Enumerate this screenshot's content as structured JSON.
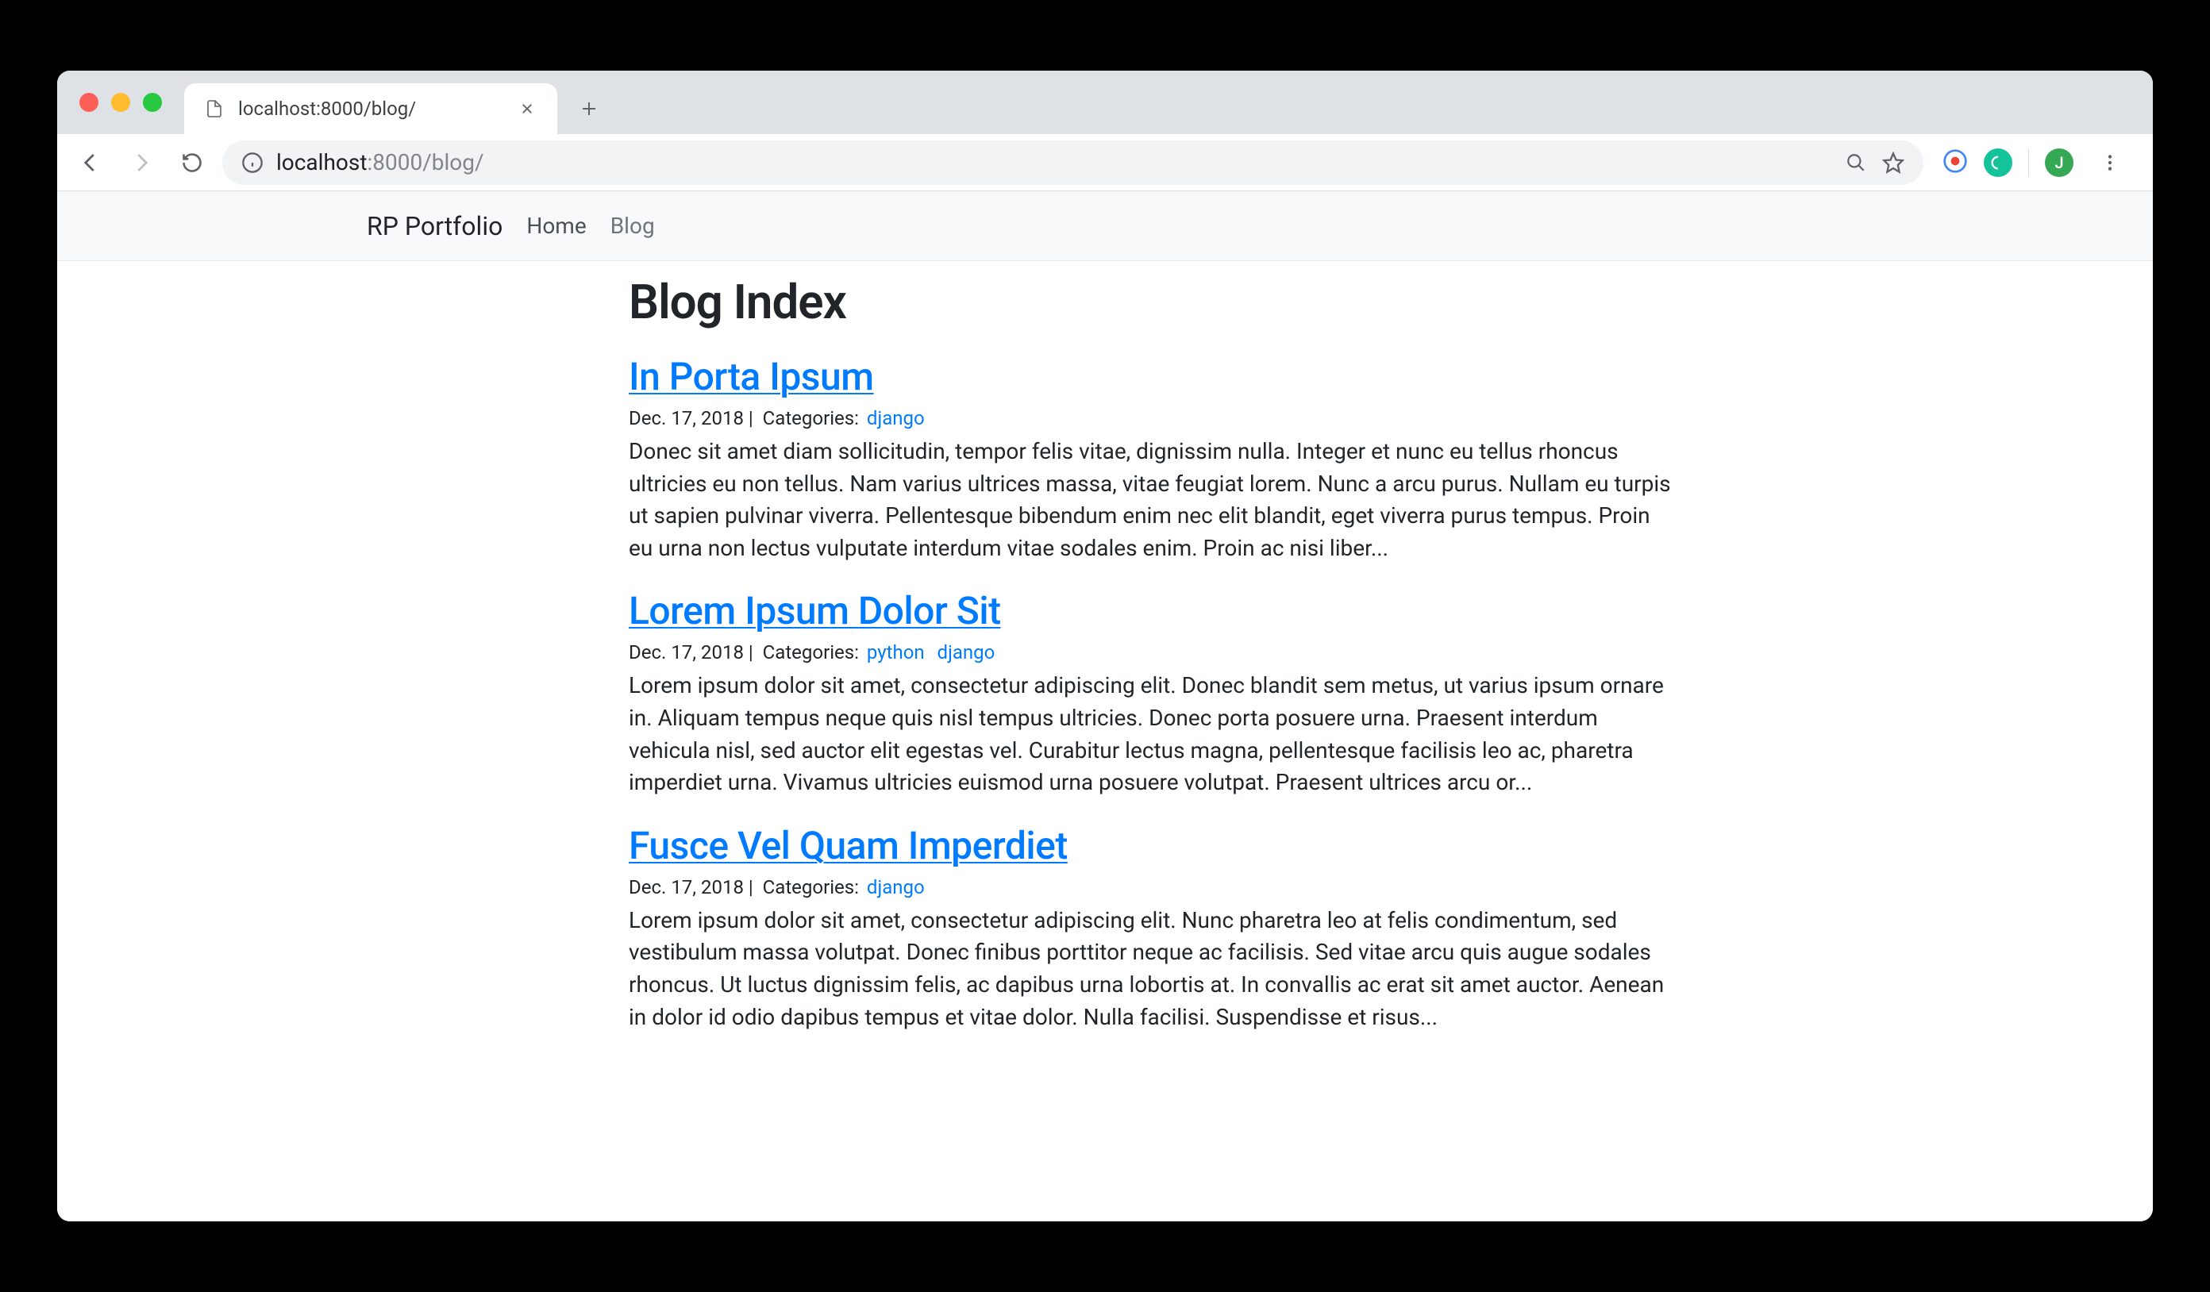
{
  "browser": {
    "tab_title": "localhost:8000/blog/",
    "url_host": "localhost",
    "url_port_path": ":8000/blog/"
  },
  "navbar": {
    "brand": "RP Portfolio",
    "links": [
      {
        "label": "Home"
      },
      {
        "label": "Blog"
      }
    ]
  },
  "page": {
    "heading": "Blog Index"
  },
  "posts": [
    {
      "title": "In Porta Ipsum",
      "date": "Dec. 17, 2018",
      "categories_label": "Categories:",
      "categories": [
        "django"
      ],
      "body": "Donec sit amet diam sollicitudin, tempor felis vitae, dignissim nulla. Integer et nunc eu tellus rhoncus ultricies eu non tellus. Nam varius ultrices massa, vitae feugiat lorem. Nunc a arcu purus. Nullam eu turpis ut sapien pulvinar viverra. Pellentesque bibendum enim nec elit blandit, eget viverra purus tempus. Proin eu urna non lectus vulputate interdum vitae sodales enim. Proin ac nisi liber..."
    },
    {
      "title": "Lorem Ipsum Dolor Sit",
      "date": "Dec. 17, 2018",
      "categories_label": "Categories:",
      "categories": [
        "python",
        "django"
      ],
      "body": "Lorem ipsum dolor sit amet, consectetur adipiscing elit. Donec blandit sem metus, ut varius ipsum ornare in. Aliquam tempus neque quis nisl tempus ultricies. Donec porta posuere urna. Praesent interdum vehicula nisl, sed auctor elit egestas vel. Curabitur lectus magna, pellentesque facilisis leo ac, pharetra imperdiet urna. Vivamus ultricies euismod urna posuere volutpat. Praesent ultrices arcu or..."
    },
    {
      "title": "Fusce Vel Quam Imperdiet",
      "date": "Dec. 17, 2018",
      "categories_label": "Categories:",
      "categories": [
        "django"
      ],
      "body": "Lorem ipsum dolor sit amet, consectetur adipiscing elit. Nunc pharetra leo at felis condimentum, sed vestibulum massa volutpat. Donec finibus porttitor neque ac facilisis. Sed vitae arcu quis augue sodales rhoncus. Ut luctus dignissim felis, ac dapibus urna lobortis at. In convallis ac erat sit amet auctor. Aenean in dolor id odio dapibus tempus et vitae dolor. Nulla facilisi. Suspendisse et risus..."
    }
  ],
  "profile_initial": "J"
}
